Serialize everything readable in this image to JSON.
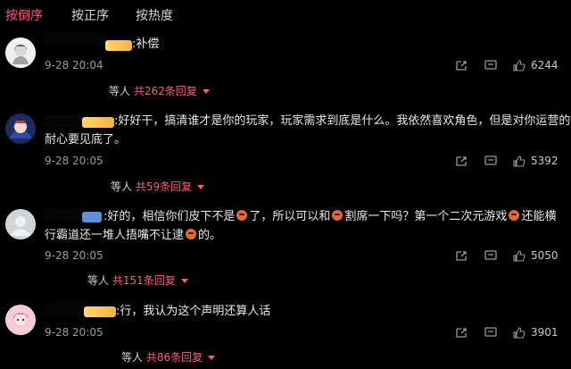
{
  "tabs": [
    {
      "label": "按倒序"
    },
    {
      "label": "按正序"
    },
    {
      "label": "按热度"
    }
  ],
  "comments": [
    {
      "text": ":补偿",
      "time": "9-28 20:04",
      "likes": "6244",
      "reply_prefix": "等人",
      "reply_count": "共262条回复"
    },
    {
      "text_line1": ":好好干，搞清谁才是你的玩家，玩家需求到底是什么。我依然喜欢角色，但是对你运营的",
      "text_line2": "耐心要见底了。",
      "time": "9-28 20:05",
      "likes": "5392",
      "reply_prefix": "等人",
      "reply_count": "共59条回复"
    },
    {
      "text_1a": "好的，相信你们皮下不是",
      "text_1b": "了，所以可以和",
      "text_1c": "割席一下吗？第一个二次元游戏",
      "text_1d": "还能横",
      "text_2a": "行霸道还一堆人捂嘴不让逮",
      "text_2b": "的。",
      "time": "9-28 20:05",
      "likes": "5050",
      "reply_prefix": "等人",
      "reply_count": "共151条回复"
    },
    {
      "text": ":行，我认为这个声明还算人话",
      "time": "9-28 20:05",
      "likes": "3901",
      "reply_prefix": "等人",
      "reply_count": "共86条回复"
    }
  ]
}
